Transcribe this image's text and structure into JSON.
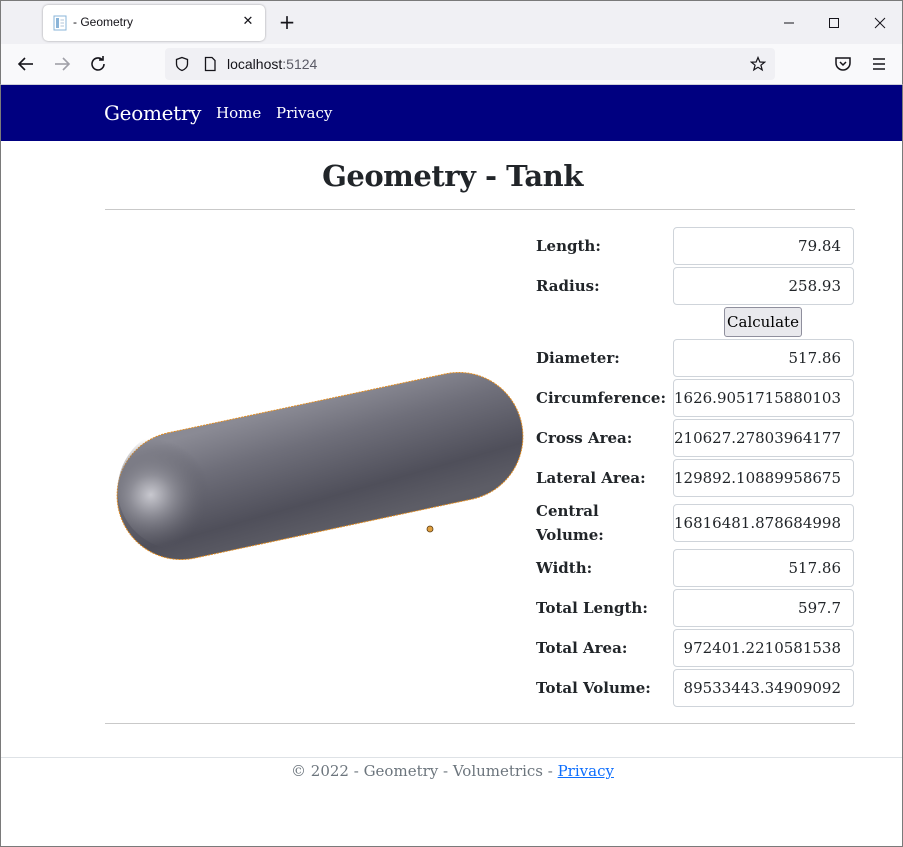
{
  "browser": {
    "tab_title": "- Geometry",
    "url_host": "localhost",
    "url_port": ":5124"
  },
  "nav": {
    "brand": "Geometry",
    "links": [
      "Home",
      "Privacy"
    ]
  },
  "page": {
    "title": "Geometry - Tank",
    "calculate_label": "Calculate"
  },
  "inputs": [
    {
      "label": "Length:",
      "value": "79.84"
    },
    {
      "label": "Radius:",
      "value": "258.93"
    }
  ],
  "results": [
    {
      "label": "Diameter:",
      "value": "517.86"
    },
    {
      "label": "Circumference:",
      "value": "1626.9051715880103"
    },
    {
      "label": "Cross Area:",
      "value": "210627.27803964177"
    },
    {
      "label": "Lateral Area:",
      "value": "129892.10889958675"
    },
    {
      "label": "Central Volume:",
      "value": "16816481.878684998"
    },
    {
      "label": "Width:",
      "value": "517.86"
    },
    {
      "label": "Total Length:",
      "value": "597.7"
    },
    {
      "label": "Total Area:",
      "value": "972401.2210581538"
    },
    {
      "label": "Total Volume:",
      "value": "89533443.34909092"
    }
  ],
  "footer": {
    "text": "© 2022 - Geometry - Volumetrics - ",
    "link": "Privacy"
  },
  "colors": {
    "navbar": "#000080",
    "tank_body": "#5e5e68",
    "tank_outline": "#e08a1e"
  },
  "icons": {
    "favicon": "document-icon",
    "tab_close": "close-icon",
    "new_tab": "plus-icon",
    "minimize": "minimize-icon",
    "maximize": "maximize-icon",
    "close_window": "close-window-icon",
    "back": "back-arrow-icon",
    "forward": "forward-arrow-icon",
    "reload": "reload-icon",
    "shield": "shield-icon",
    "page": "page-icon",
    "bookmark": "star-icon",
    "pocket": "pocket-icon",
    "menu": "hamburger-menu-icon"
  }
}
